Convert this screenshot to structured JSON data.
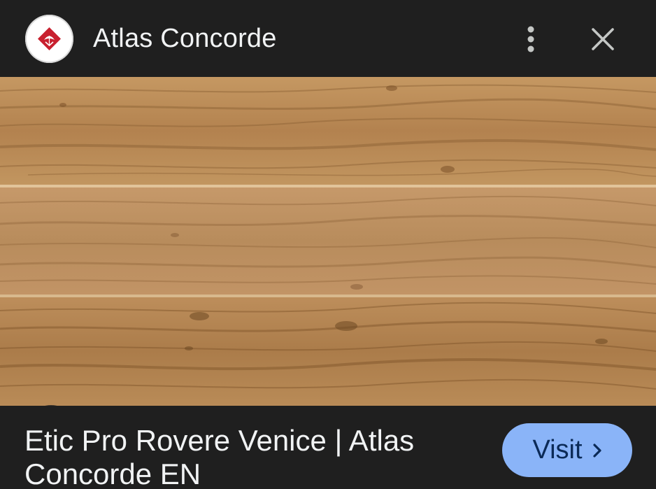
{
  "header": {
    "site_name": "Atlas Concorde",
    "logo_icon": "atlas-concorde-logo",
    "more_icon": "more-vert-icon",
    "close_icon": "close-icon"
  },
  "image": {
    "subject": "wood plank tiles",
    "lens_icon": "google-lens-icon"
  },
  "footer": {
    "title": "Etic Pro Rovere Venice | Atlas Concorde EN",
    "visit_label": "Visit",
    "visit_icon": "chevron-right-icon"
  },
  "colors": {
    "background": "#1f1f1f",
    "visit_button": "#8ab4f8",
    "logo_red": "#c8202f"
  }
}
